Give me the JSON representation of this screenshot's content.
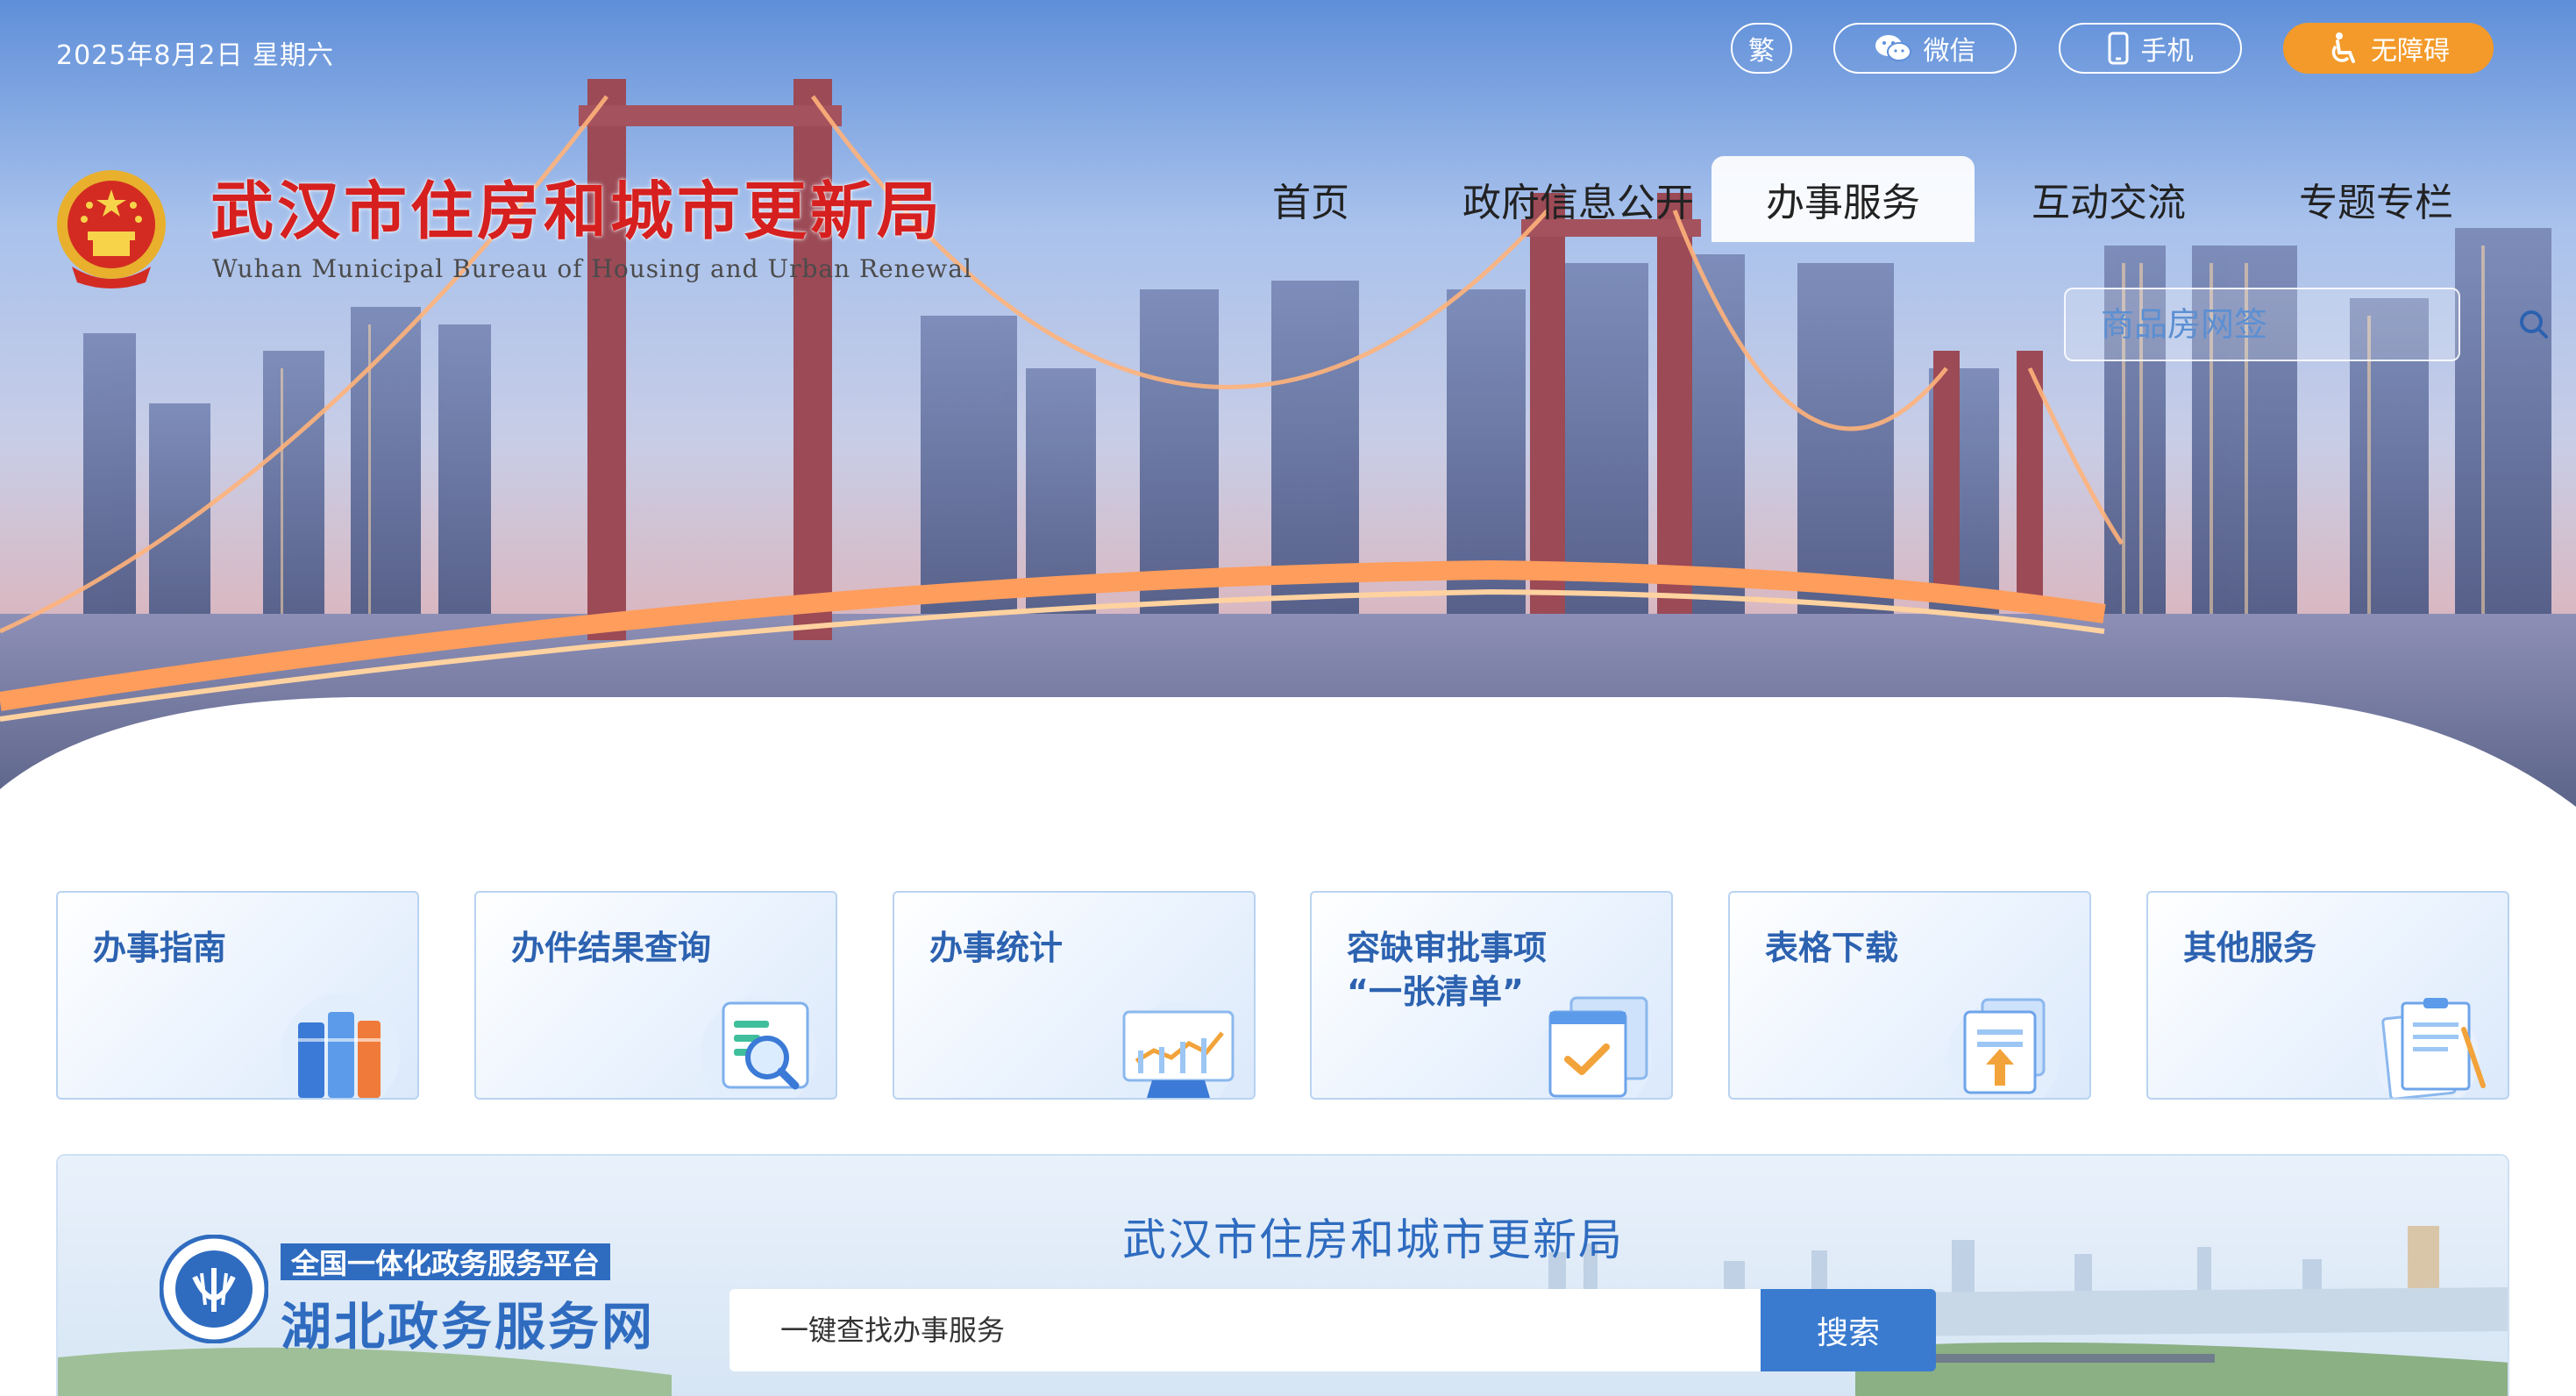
{
  "topbar": {
    "date": "2025年8月2日 星期六",
    "traditional_label": "繁",
    "wechat_label": "微信",
    "mobile_label": "手机",
    "accessibility_label": "无障碍"
  },
  "header": {
    "title_cn": "武汉市住房和城市更新局",
    "title_en": "Wuhan Municipal Bureau of Housing and Urban Renewal"
  },
  "nav": {
    "items": [
      "首页",
      "政府信息公开",
      "办事服务",
      "互动交流",
      "专题专栏"
    ],
    "active": "办事服务"
  },
  "search": {
    "placeholder": "商品房网签"
  },
  "services": {
    "cards": [
      {
        "title": "办事指南",
        "icon": "books-icon"
      },
      {
        "title": "办件结果查询",
        "icon": "document-search-icon"
      },
      {
        "title": "办事统计",
        "icon": "chart-monitor-icon"
      },
      {
        "title": "容缺审批事项",
        "title_line2": "“一张清单”",
        "icon": "checklist-icon"
      },
      {
        "title": "表格下载",
        "icon": "download-document-icon"
      },
      {
        "title": "其他服务",
        "icon": "clipboard-icon"
      }
    ]
  },
  "platform": {
    "badge": "全国一体化政务服务平台",
    "name": "湖北政务服务网",
    "title": "武汉市住房和城市更新局",
    "search_placeholder": "一键查找办事服务",
    "search_button": "搜索"
  },
  "colors": {
    "title_red": "#d6201f",
    "accent_blue": "#2c62b0",
    "accessibility_orange": "#f39a2a",
    "button_blue": "#3a7bd0"
  }
}
